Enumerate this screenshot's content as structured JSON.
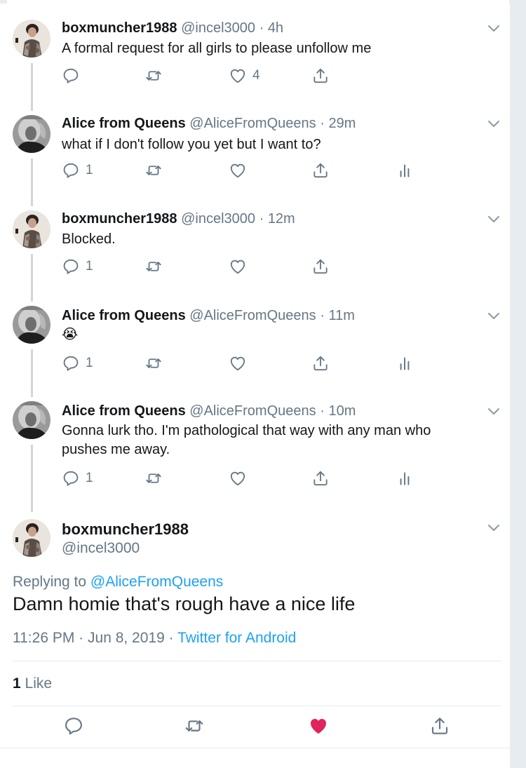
{
  "tweets": [
    {
      "name": "boxmuncher1988",
      "handle": "@incel3000",
      "time": "4h",
      "text": "A formal request for all girls to please unfollow me",
      "reply_count": "",
      "like_count": "4",
      "analytics": false
    },
    {
      "name": "Alice from Queens",
      "handle": "@AliceFromQueens",
      "time": "29m",
      "text": "what if I don't follow you yet but I want to?",
      "reply_count": "1",
      "like_count": "",
      "analytics": true
    },
    {
      "name": "boxmuncher1988",
      "handle": "@incel3000",
      "time": "12m",
      "text": "Blocked.",
      "reply_count": "1",
      "like_count": "",
      "analytics": false
    },
    {
      "name": "Alice from Queens",
      "handle": "@AliceFromQueens",
      "time": "11m",
      "text": "😭",
      "reply_count": "1",
      "like_count": "",
      "analytics": true
    },
    {
      "name": "Alice from Queens",
      "handle": "@AliceFromQueens",
      "time": "10m",
      "text": "Gonna lurk tho. I'm pathological that way with any man who pushes me away.",
      "reply_count": "1",
      "like_count": "",
      "analytics": true
    }
  ],
  "focus": {
    "name": "boxmuncher1988",
    "handle": "@incel3000",
    "replying_label": "Replying to",
    "replying_to": "@AliceFromQueens",
    "text": "Damn homie that's rough have a nice life",
    "time": "11:26 PM",
    "date": "Jun 8, 2019",
    "source": "Twitter for Android",
    "like_count": "1",
    "like_label": "Like",
    "liked": true
  },
  "separator": "·",
  "colors": {
    "accent": "#1da1f2",
    "like": "#e0245e",
    "muted": "#657786",
    "text": "#14171a",
    "thread_line": "#ccd6dd"
  },
  "icons": [
    "reply-icon",
    "retweet-icon",
    "like-icon",
    "share-icon",
    "analytics-icon",
    "chevron-down-icon"
  ]
}
